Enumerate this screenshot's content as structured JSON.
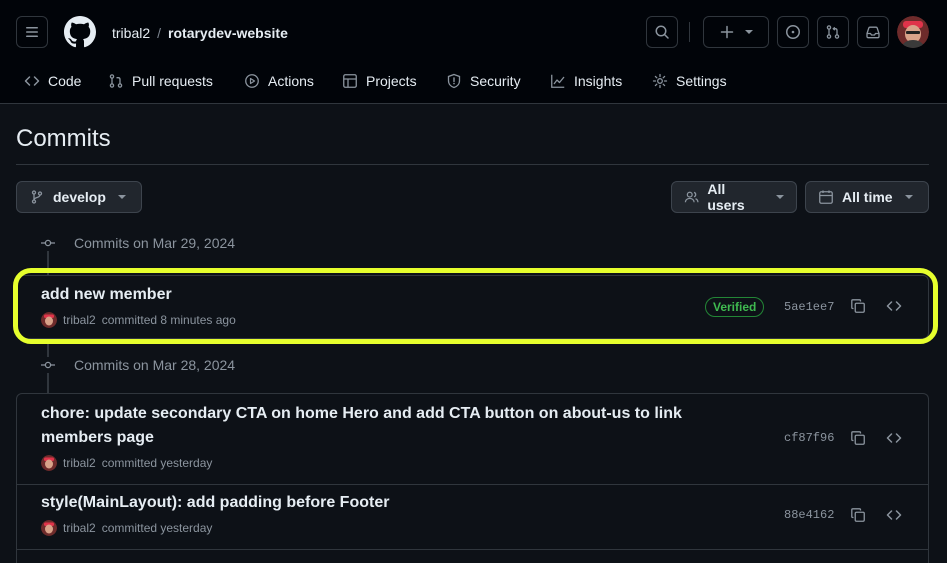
{
  "header": {
    "owner": "tribal2",
    "separator": "/",
    "repo": "rotarydev-website"
  },
  "nav": {
    "code": "Code",
    "pulls": "Pull requests",
    "actions": "Actions",
    "projects": "Projects",
    "security": "Security",
    "insights": "Insights",
    "settings": "Settings"
  },
  "page": {
    "title": "Commits"
  },
  "filters": {
    "branch": "develop",
    "users": "All users",
    "time": "All time"
  },
  "groups": [
    {
      "heading": "Commits on Mar 29, 2024",
      "commits": [
        {
          "message": "add new member",
          "author": "tribal2",
          "when": "committed 8 minutes ago",
          "badge": "Verified",
          "sha": "5ae1ee7"
        }
      ]
    },
    {
      "heading": "Commits on Mar 28, 2024",
      "commits": [
        {
          "message_line1": "chore: update secondary CTA on home Hero and add CTA button on about-us to link",
          "message_line2": "members page",
          "author": "tribal2",
          "when": "committed yesterday",
          "sha": "cf87f96"
        },
        {
          "message": "style(MainLayout): add padding before Footer",
          "author": "tribal2",
          "when": "committed yesterday",
          "sha": "88e4162"
        }
      ]
    }
  ],
  "colors": {
    "background": "#0d1117",
    "header_bg": "#010409",
    "border": "#30363d",
    "verified": "#3fb950",
    "highlight": "#e6ff2d",
    "nav_active": "#f78166"
  },
  "icons": {
    "menu": "hamburger-icon",
    "logo": "github-mark-icon",
    "search": "search-icon",
    "plus": "plus-icon",
    "issues": "issue-opened-icon",
    "pulls": "git-pull-request-icon",
    "inbox": "inbox-icon",
    "branch": "git-branch-icon",
    "users": "people-icon",
    "calendar": "calendar-icon",
    "commit": "git-commit-icon",
    "copy": "copy-icon",
    "browse": "code-icon"
  }
}
